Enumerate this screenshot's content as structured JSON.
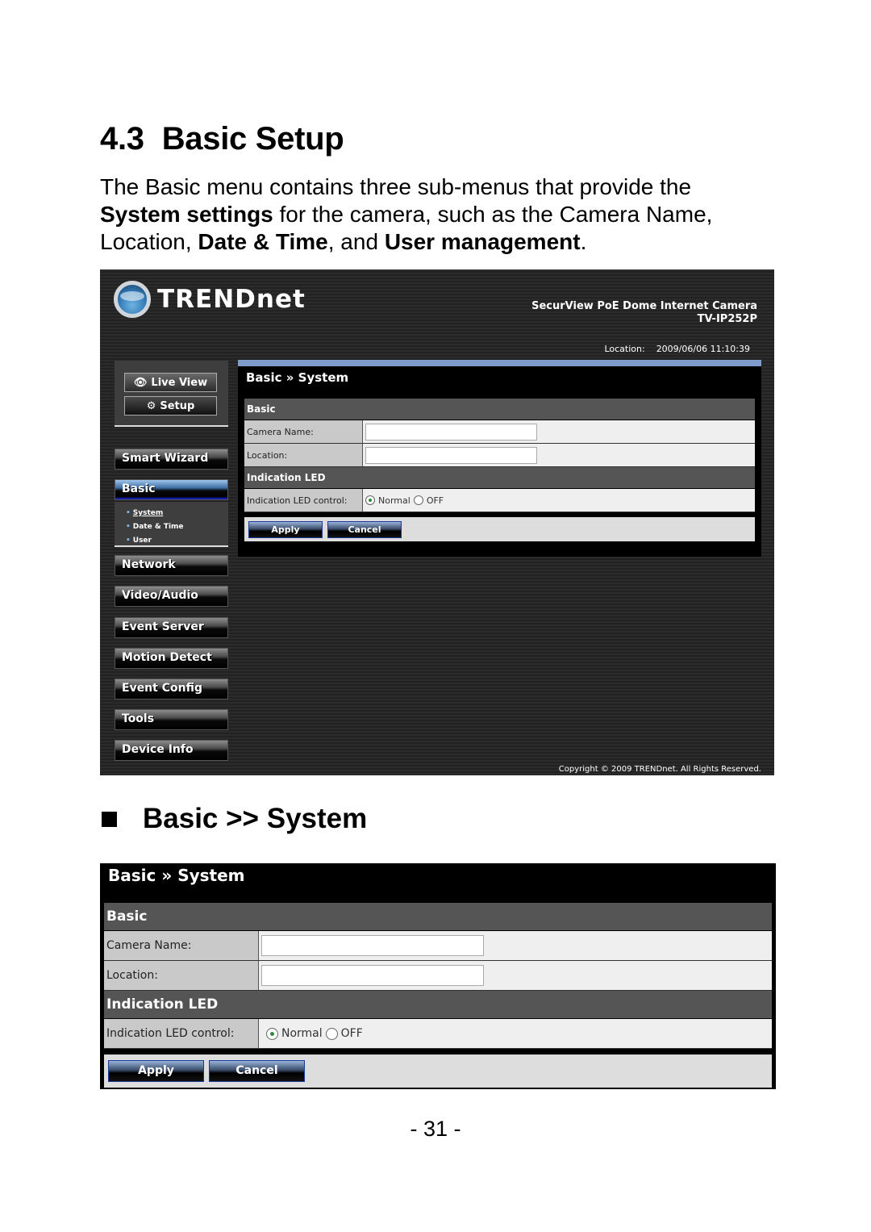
{
  "document": {
    "section_number": "4.3",
    "section_title": "Basic Setup",
    "intro": {
      "p1": "The Basic menu contains three sub-menus that provide the ",
      "b1": "System settings",
      "p2": " for the camera, such as the Camera Name, Location, ",
      "b2": "Date & Time",
      "p3": ", and ",
      "b3": "User management",
      "p4": "."
    },
    "subheading": "Basic >> System",
    "page_number": "- 31 -"
  },
  "camera_ui": {
    "brand": "TRENDnet",
    "product_name": "SecurView PoE Dome Internet Camera",
    "model": "TV-IP252P",
    "location_label": "Location:",
    "datetime": "2009/06/06 11:10:39",
    "top_buttons": [
      {
        "label": "Live View",
        "icon": "eye-icon"
      },
      {
        "label": "Setup",
        "icon": "gears-icon"
      }
    ],
    "nav": [
      {
        "label": "Smart Wizard",
        "active": false
      },
      {
        "label": "Basic",
        "active": true
      },
      {
        "label": "Network",
        "active": false
      },
      {
        "label": "Video/Audio",
        "active": false
      },
      {
        "label": "Event Server",
        "active": false
      },
      {
        "label": "Motion Detect",
        "active": false
      },
      {
        "label": "Event Config",
        "active": false
      },
      {
        "label": "Tools",
        "active": false
      },
      {
        "label": "Device Info",
        "active": false
      }
    ],
    "submenu": [
      {
        "label": "System",
        "current": true
      },
      {
        "label": "Date & Time",
        "current": false
      },
      {
        "label": "User",
        "current": false
      }
    ],
    "copyright": "Copyright © 2009 TRENDnet. All Rights Reserved."
  },
  "form": {
    "title": "Basic » System",
    "section_basic": "Basic",
    "camera_name_label": "Camera Name:",
    "camera_name_value": "",
    "location_label": "Location:",
    "location_value": "",
    "section_led": "Indication LED",
    "led_label": "Indication LED control:",
    "led_options": [
      {
        "label": "Normal",
        "selected": true
      },
      {
        "label": "OFF",
        "selected": false
      }
    ],
    "apply_label": "Apply",
    "cancel_label": "Cancel"
  }
}
